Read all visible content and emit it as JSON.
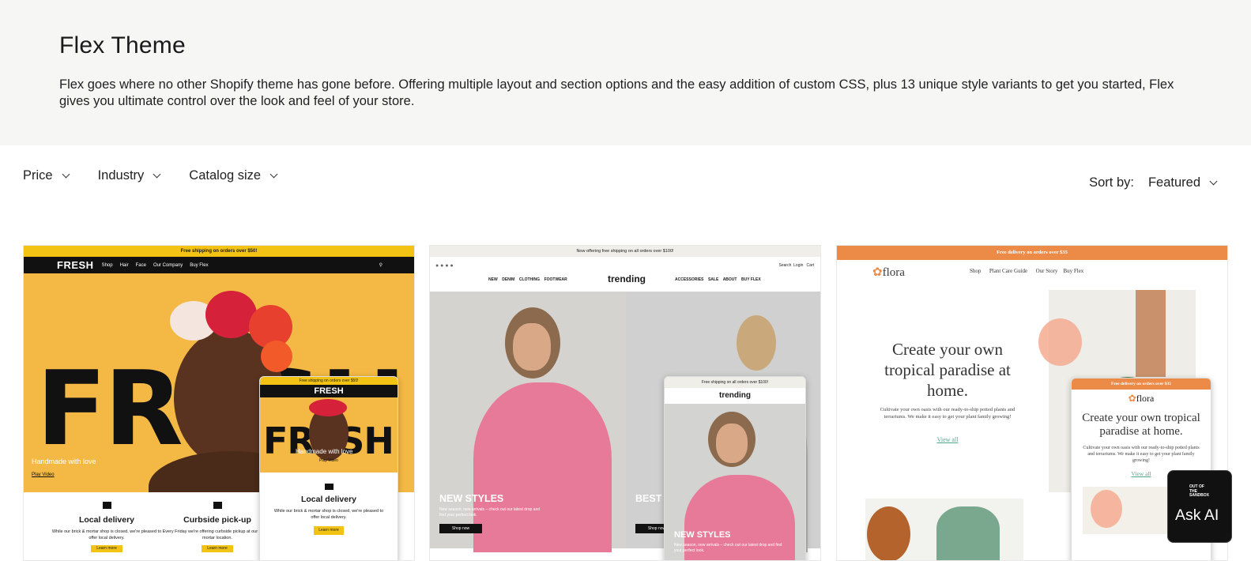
{
  "header": {
    "title": "Flex Theme",
    "description": "Flex goes where no other Shopify theme has gone before. Offering multiple layout and section options and the easy addition of custom CSS, plus 13 unique style variants to get you started, Flex gives you ultimate control over the look and feel of your store."
  },
  "filters": [
    {
      "label": "Price"
    },
    {
      "label": "Industry"
    },
    {
      "label": "Catalog size"
    }
  ],
  "sort": {
    "label": "Sort by:",
    "value": "Featured"
  },
  "cards": {
    "fresh": {
      "announcement": "Free shipping on orders over $50!",
      "logo": "FRESH",
      "nav": [
        "Shop",
        "Hair",
        "Face",
        "Our Company",
        "Buy Flex"
      ],
      "hero_word": "FRESH",
      "tagline": "Handmade with love",
      "video_link": "Play Video",
      "features": [
        {
          "title": "Local delivery",
          "text": "While our brick & mortar shop is closed, we're pleased to offer local delivery.",
          "button": "Learn more"
        },
        {
          "title": "Curbside pick-up",
          "text": "Every Friday we're offering curbside pickup at our brick & mortar location.",
          "button": "Learn more"
        }
      ],
      "mobile": {
        "announcement": "Free shipping on orders over $50!",
        "logo": "FRESH",
        "tagline": "Handmade with love",
        "video_link": "Play Video",
        "feature_title": "Local delivery",
        "feature_text": "While our brick & mortar shop is closed, we're pleased to offer local delivery.",
        "button": "Learn more"
      }
    },
    "trending": {
      "announcement": "Now offering free shipping on all orders over $100!",
      "logo": "trending",
      "nav_left": [
        "NEW",
        "DENIM",
        "CLOTHING",
        "FOOTWEAR"
      ],
      "nav_right": [
        "ACCESSORIES",
        "SALE",
        "ABOUT",
        "BUY FLEX"
      ],
      "utility": [
        "Search",
        "Login",
        "Cart"
      ],
      "slide1_title": "NEW STYLES",
      "slide1_text": "New season, new arrivals – check out our latest drop and find your perfect look.",
      "slide1_button": "Shop now",
      "slide2_title": "BEST S",
      "slide2_button": "Shop now",
      "mobile": {
        "announcement": "Free shipping on all orders over $100!",
        "logo": "trending",
        "slide_title": "NEW STYLES",
        "slide_text": "New season, new arrivals – check out our latest drop and find your perfect look."
      }
    },
    "flora": {
      "announcement": "Free delivery on orders over $35",
      "logo": "flora",
      "nav": [
        "Shop",
        "Plant Care Guide",
        "Our Story",
        "Buy Flex"
      ],
      "headline": "Create your own tropical paradise at home.",
      "text": "Cultivate your own oasis with our ready-to-ship potted plants and terrariums. We make it easy to get your plant family growing!",
      "link": "View all",
      "mobile": {
        "announcement": "Free delivery on orders over $35",
        "logo": "flora",
        "headline": "Create your own tropical paradise at home.",
        "text": "Cultivate your own oasis with our ready-to-ship potted plants and terrariums. We make it easy to get your plant family growing!",
        "link": "View all"
      }
    }
  },
  "ask_ai": {
    "brand": "OUT OF THE SANDBOX",
    "label": "Ask AI"
  },
  "colors": {
    "fresh_yellow": "#f2c314",
    "fresh_bg": "#f4b944",
    "flora_orange": "#ec8b47",
    "trending_pink": "#e77a98",
    "flora_green": "#4fa88a"
  }
}
